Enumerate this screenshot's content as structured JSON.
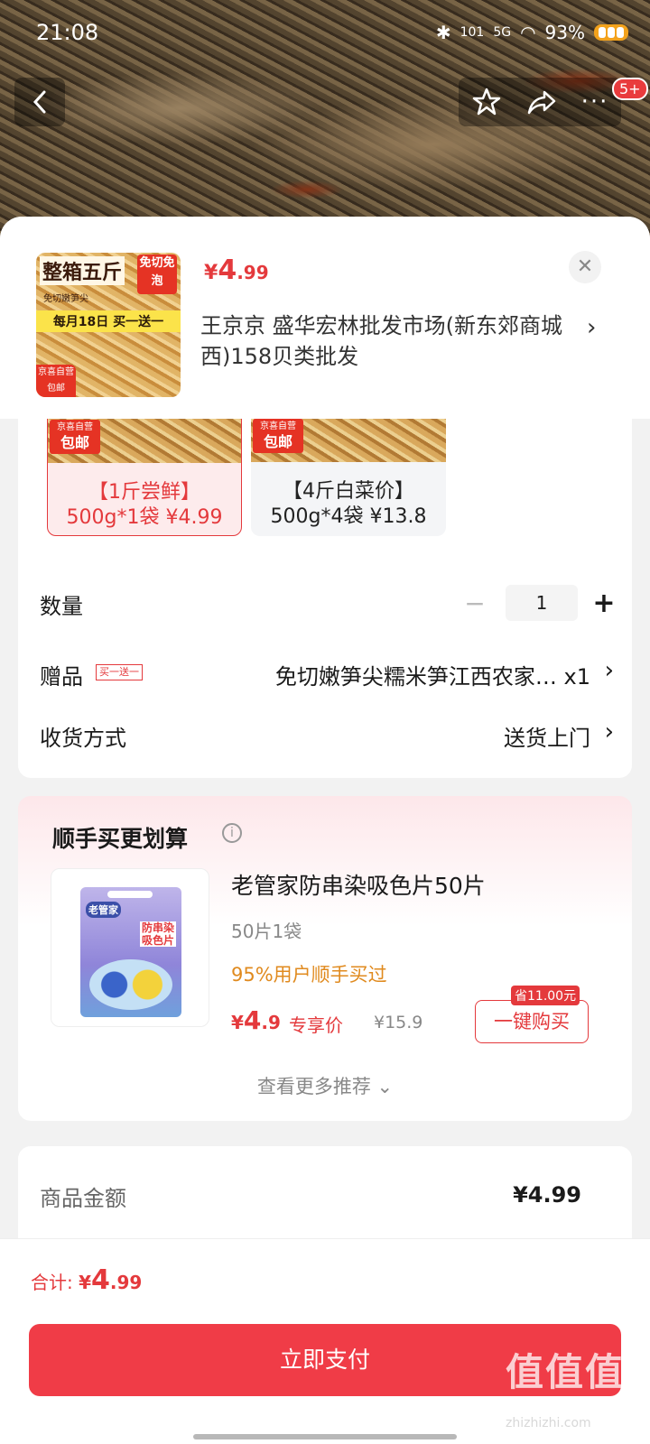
{
  "status": {
    "time": "21:08",
    "net_speed": "101",
    "net_unit": "KB/s",
    "signal": "5G",
    "battery": "93%"
  },
  "product": {
    "price_currency": "¥",
    "price_int": "4",
    "price_dec": ".99",
    "thumb": {
      "title": "整箱五斤",
      "badge": "免切免泡",
      "sub": "免切嫩笋尖",
      "promo": "每月18日 买一送一",
      "tag": "京喜自营包邮"
    },
    "address": "王京京  盛华宏林批发市场(新东郊商城西)158贝类批发"
  },
  "options": [
    {
      "tag_top": "京喜自营",
      "tag_bottom": "包邮",
      "line1": "【1斤尝鲜】",
      "line2": "500g*1袋  ¥4.99",
      "selected": true
    },
    {
      "tag_top": "京喜自营",
      "tag_bottom": "包邮",
      "line1": "【4斤白菜价】",
      "line2": "500g*4袋  ¥13.8",
      "selected": false
    }
  ],
  "quantity": {
    "label": "数量",
    "value": "1",
    "minus": "−",
    "plus": "+"
  },
  "gift": {
    "label": "赠品",
    "tag": "买一送一",
    "value": "免切嫩笋尖糯米笋江西农家… x1"
  },
  "delivery": {
    "label": "收货方式",
    "value": "送货上门"
  },
  "recommend": {
    "title": "顺手买更划算",
    "product_name": "老管家防串染吸色片50片",
    "spec": "50片1袋",
    "buy_rate": "95%用户顺手买过",
    "price_currency": "¥",
    "price_int": "4",
    "price_dec": ".9",
    "exclusive": "专享价",
    "original": "¥15.9",
    "save_tag": "省11.00元",
    "buy_button": "一键购买",
    "more": "查看更多推荐 ⌄",
    "pack_brand": "老管家",
    "pack_title": "防串染吸色片"
  },
  "amount": {
    "label": "商品金额",
    "value": "¥4.99"
  },
  "footer": {
    "total_label": "合计: ",
    "currency": "¥",
    "total_int": "4",
    "total_dec": ".99",
    "pay_button": "立即支付",
    "watermark": "值值值",
    "watermark_url": "zhizhizhi.com"
  },
  "badge_count": "5+",
  "colors": {
    "accent": "#e4393c",
    "pay": "#f03c47",
    "buy_rate": "#e08a1e"
  }
}
